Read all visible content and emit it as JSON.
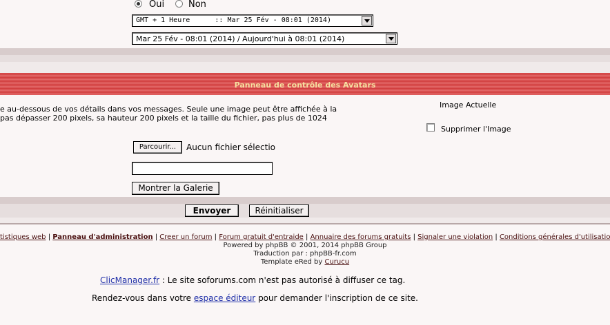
{
  "prefs": {
    "radio_yes": "Oui",
    "radio_no": "Non",
    "timezone_value": "GMT + 1 Heure      :: Mar 25 Fév - 08:01 (2014)",
    "date_format_value": "Mar 25 Fév - 08:01 (2014) / Aujourd'hui à 08:01 (2014)"
  },
  "avatar": {
    "panel_title": "Panneau de contrôle des Avatars",
    "description_line1": "e au-dessous de vos détails dans vos messages. Seule une image peut être affichée à la",
    "description_line2": " pas dépasser 200 pixels, sa hauteur 200 pixels et la taille du fichier, pas plus de 1024",
    "current_image_label": "Image Actuelle",
    "delete_image_label": "Supprimer l'Image",
    "browse_button": "Parcourir...",
    "no_file_text": "Aucun fichier sélectio",
    "url_input_value": "",
    "gallery_button": "Montrer la Galerie"
  },
  "actions": {
    "submit": "Envoyer",
    "reset": "Réinitialiser"
  },
  "footer": {
    "links": [
      {
        "label": "tistiques web",
        "bold": false
      },
      {
        "label": "Panneau d'administration",
        "bold": true
      },
      {
        "label": "Creer un forum",
        "bold": false
      },
      {
        "label": "Forum gratuit d'entraide",
        "bold": false
      },
      {
        "label": "Annuaire des forums gratuits",
        "bold": false
      },
      {
        "label": "Signaler une violation",
        "bold": false
      },
      {
        "label": "Conditions générales d'utilisation",
        "bold": false
      }
    ],
    "separator": " | ",
    "powered": "Powered by phpBB © 2001, 2014 phpBB Group",
    "translation": "Traduction par : phpBB-fr.com",
    "template_prefix": "Template eRed by ",
    "template_author": "Curucu",
    "clic_link": "ClicManager.fr",
    "clic_text": " : Le site soforums.com n'est pas autorisé à diffuser ce tag.",
    "editor_prefix": "Rendez-vous dans votre ",
    "editor_link": "espace éditeur",
    "editor_suffix": " pour demander l'inscription de ce site."
  }
}
